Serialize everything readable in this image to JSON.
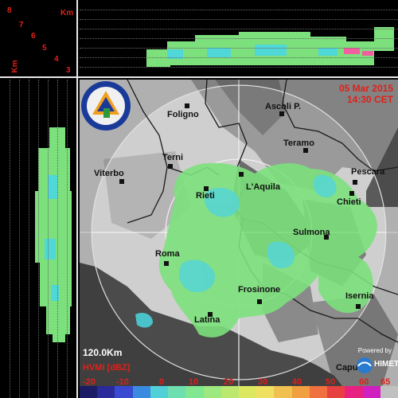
{
  "km_labels": [
    "8",
    "7",
    "6",
    "5",
    "4",
    "3"
  ],
  "km_unit": "Km",
  "km_unit_top": "Km",
  "date": "05 Mar 2015",
  "time": "14:30 CET",
  "range": "120.0Km",
  "legend_title": "HVMI [dBZ]",
  "powered_by": "Powered by",
  "brand": "HIMET",
  "logo_text": "PROTEZIONE CIVILE REGIONE ABRUZZO",
  "legend_ticks": [
    "-20",
    "-10",
    "0",
    "10",
    "20",
    "30",
    "40",
    "50",
    "60",
    "65"
  ],
  "legend_colors": [
    "#1c1c64",
    "#2a2a9a",
    "#3a4ad0",
    "#3a8ae0",
    "#52d0d8",
    "#6ee0b0",
    "#80e890",
    "#9ee880",
    "#bce870",
    "#dce860",
    "#f0e060",
    "#f0c050",
    "#f0a040",
    "#f07040",
    "#e84040",
    "#e82080",
    "#d020c0",
    "#c0c0c0"
  ],
  "cities": [
    {
      "name": "Foligno"
    },
    {
      "name": "Ascoli P."
    },
    {
      "name": "Teramo"
    },
    {
      "name": "Terni"
    },
    {
      "name": "Viterbo"
    },
    {
      "name": "Pescara"
    },
    {
      "name": "Rieti"
    },
    {
      "name": "L'Aquila"
    },
    {
      "name": "Chieti"
    },
    {
      "name": "Sulmona"
    },
    {
      "name": "Roma"
    },
    {
      "name": "Frosinone"
    },
    {
      "name": "Isernia"
    },
    {
      "name": "Latina"
    },
    {
      "name": "Capua"
    }
  ]
}
